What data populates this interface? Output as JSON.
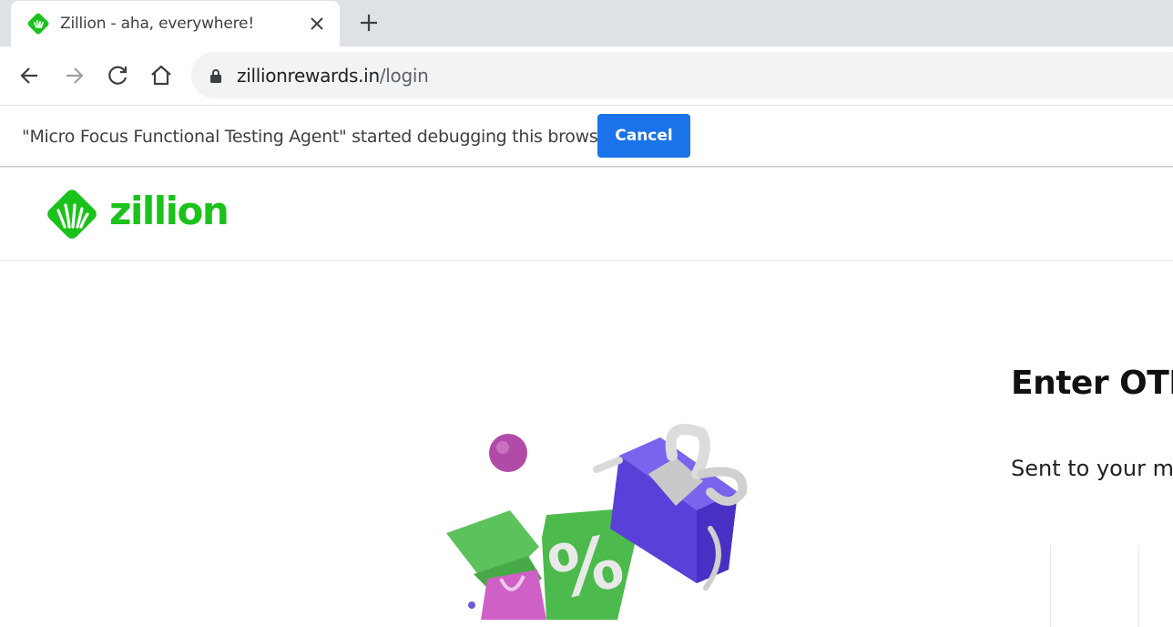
{
  "browser": {
    "tab": {
      "title": "Zillion - aha, everywhere!",
      "favicon": "zillion-logo-icon"
    },
    "toolbar": {
      "back_icon": "arrow-left-icon",
      "forward_icon": "arrow-right-icon",
      "reload_icon": "reload-icon",
      "home_icon": "home-icon",
      "url_host": "zillionrewards.in",
      "url_path": "/login"
    },
    "infobar": {
      "message": "\"Micro Focus Functional Testing Agent\" started debugging this browser",
      "cancel_label": "Cancel"
    }
  },
  "page": {
    "logo_text": "zillion",
    "otp_title": "Enter OTP",
    "otp_subtitle": "Sent to your mo"
  },
  "colors": {
    "brand_green": "#1bc21b",
    "button_blue": "#1a73e8",
    "tabstrip": "#dee1e6"
  }
}
